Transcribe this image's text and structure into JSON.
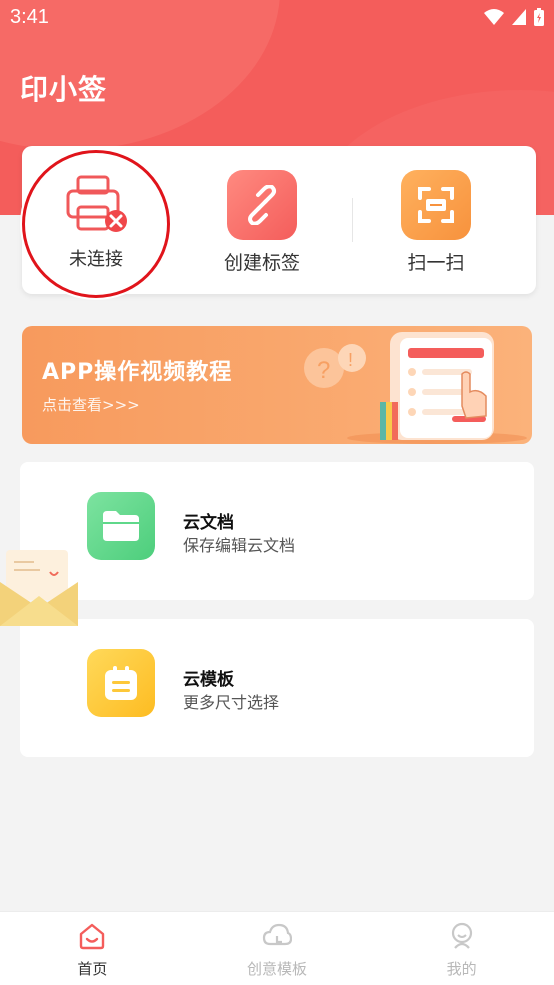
{
  "status": {
    "time": "3:41"
  },
  "app": {
    "title": "印小签"
  },
  "quick": {
    "connect_label": "未连接",
    "create_label": "创建标签",
    "scan_label": "扫一扫"
  },
  "banner": {
    "title": "APP操作视频教程",
    "subtitle": "点击查看>>>"
  },
  "cards": [
    {
      "title": "云文档",
      "subtitle": "保存编辑云文档",
      "icon": "folder-icon",
      "color": "#5fd88a"
    },
    {
      "title": "云模板",
      "subtitle": "更多尺寸选择",
      "icon": "calendar-icon",
      "color": "#fdc83a"
    }
  ],
  "nav": {
    "items": [
      {
        "label": "首页",
        "icon": "home-icon",
        "active": true
      },
      {
        "label": "创意模板",
        "icon": "cloud-icon",
        "active": false
      },
      {
        "label": "我的",
        "icon": "profile-icon",
        "active": false
      }
    ]
  },
  "colors": {
    "brand": "#f45d5b",
    "accent_red": "#e0141b",
    "banner": "#f79a5d"
  }
}
